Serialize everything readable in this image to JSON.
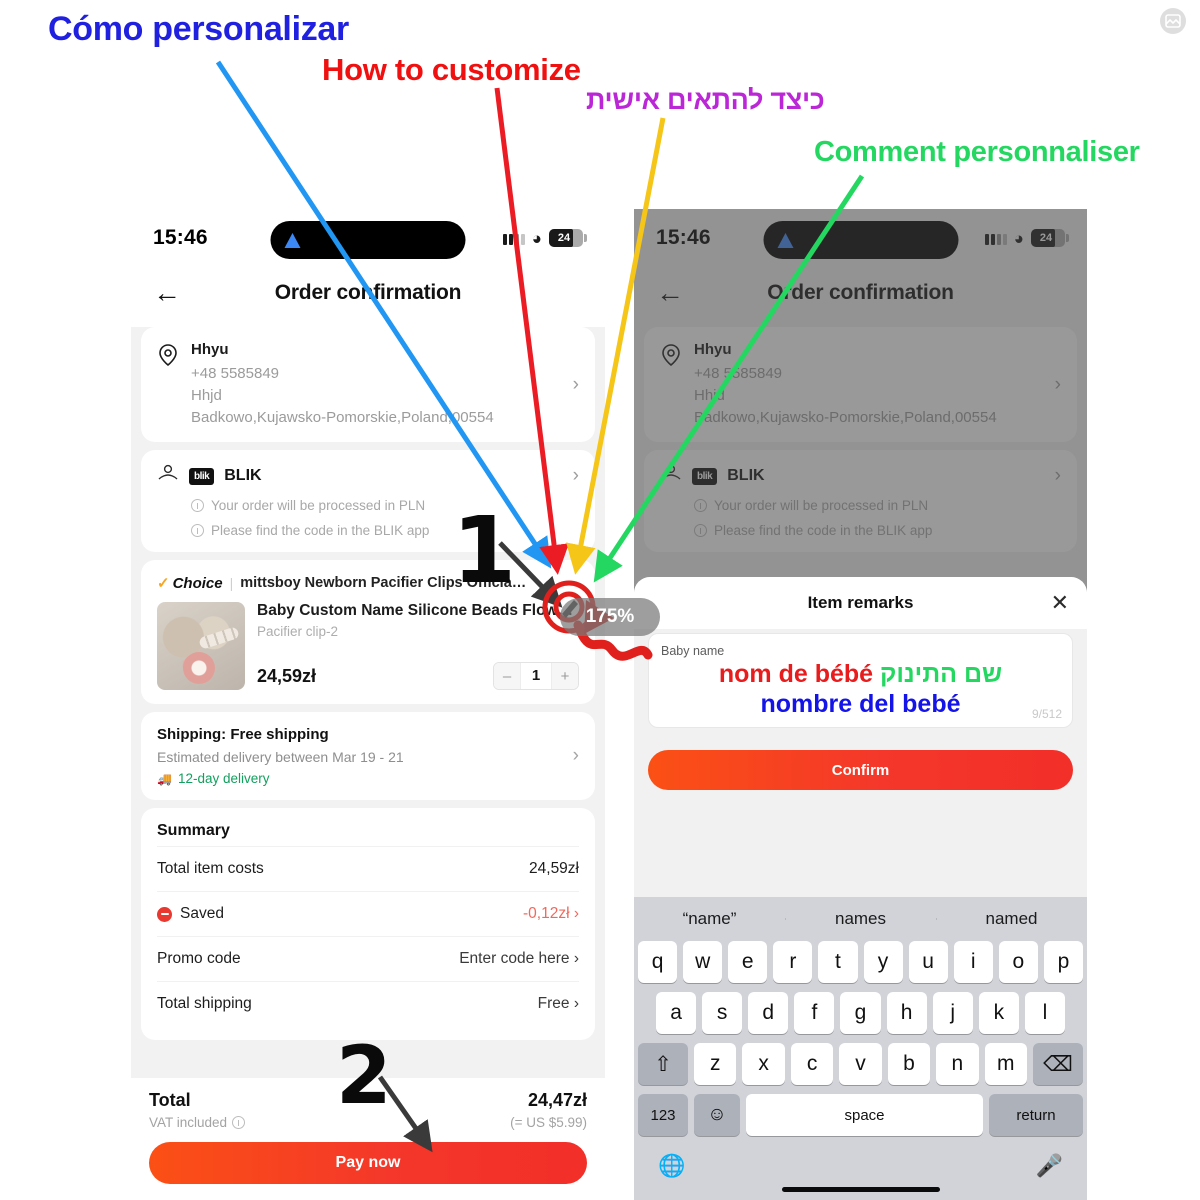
{
  "annotations": {
    "labels": [
      {
        "id": "anno-es",
        "text": "Cómo personalizar",
        "color": "#2020e0"
      },
      {
        "id": "anno-en",
        "text": "How to customize",
        "color": "#f01010"
      },
      {
        "id": "anno-he",
        "text": "כיצד להתאים אישית",
        "color": "#bb27d6"
      },
      {
        "id": "anno-fr",
        "text": "Comment personnaliser",
        "color": "#24d760"
      }
    ],
    "step_one": "1",
    "step_two": "2",
    "zoom_badge": "175%"
  },
  "phone_left": {
    "status": {
      "time": "15:46",
      "battery": "24",
      "wifi_icon": "wifi-icon",
      "signal_icon": "signal-dots-icon",
      "nav_icon": "navigation-arrow-icon"
    },
    "header": {
      "back_icon": "back-arrow-icon",
      "title": "Order confirmation"
    },
    "address": {
      "pin_icon": "location-pin-icon",
      "name": "Hhyu",
      "phone": "+48 5585849",
      "line2": "Hhjd",
      "line3": "Badkowo,Kujawsko-Pomorskie,Poland,00554",
      "chevron": "›"
    },
    "payment": {
      "wallet_icon": "wallet-hand-icon",
      "logo_text": "blik",
      "name": "BLIK",
      "chevron": "›",
      "note1": "Your order will be processed in PLN",
      "note2": "Please find the code in the BLIK app"
    },
    "product": {
      "choice_label": "Choice",
      "choice_tick": "✓",
      "separator": "|",
      "store": "mittsboy Newborn Pacifier Clips Official St...",
      "title": "Baby Custom Name Silicone Beads Flower...",
      "variant": "Pacifier clip-2",
      "price": "24,59zł",
      "qty": "1",
      "minus": "–",
      "plus": "+",
      "edit_icon": "pencil-edit-icon"
    },
    "shipping": {
      "title": "Shipping: Free shipping",
      "estimate": "Estimated delivery between Mar 19 - 21",
      "fast": "12-day delivery",
      "truck_icon": "truck-icon",
      "chevron": "›"
    },
    "summary": {
      "title": "Summary",
      "rows": [
        {
          "label": "Total item costs",
          "value": "24,59zł",
          "style": "plain",
          "chevron": ""
        },
        {
          "label": "Saved",
          "value": "-0,12zł",
          "style": "neg",
          "chevron": "›"
        },
        {
          "label": "Promo code",
          "value": "Enter code here",
          "style": "muted",
          "chevron": "›"
        },
        {
          "label": "Total shipping",
          "value": "Free",
          "style": "muted",
          "chevron": "›"
        }
      ]
    },
    "bottom": {
      "total_label": "Total",
      "vat_text": "VAT included",
      "vat_icon": "info-icon",
      "total_amount": "24,47zł",
      "total_usd": "(= US $5.99)",
      "pay_button": "Pay now"
    }
  },
  "phone_right": {
    "status": {
      "time": "15:46",
      "battery": "24",
      "wifi_icon": "wifi-icon",
      "signal_icon": "signal-dots-icon",
      "nav_icon": "navigation-arrow-icon"
    },
    "header": {
      "back_icon": "back-arrow-icon",
      "title": "Order confirmation"
    },
    "address": {
      "pin_icon": "location-pin-icon",
      "name": "Hhyu",
      "phone": "+48 5585849",
      "line2": "Hhjd",
      "line3": "Badkowo,Kujawsko-Pomorskie,Poland,00554",
      "chevron": "›"
    },
    "payment": {
      "wallet_icon": "wallet-hand-icon",
      "logo_text": "blik",
      "name": "BLIK",
      "chevron": "›",
      "note1": "Your order will be processed in PLN",
      "note2": "Please find the code in the BLIK app"
    },
    "sheet": {
      "title": "Item remarks",
      "close_icon": "close-x-icon",
      "field_label": "Baby name",
      "value_fr": "nom de bébé",
      "value_he": "שם התינוק",
      "value_es": "nombre del bebé",
      "char_count": "9/512",
      "confirm_button": "Confirm"
    },
    "keyboard": {
      "predictions": [
        "“name”",
        "names",
        "named"
      ],
      "row1": [
        "q",
        "w",
        "e",
        "r",
        "t",
        "y",
        "u",
        "i",
        "o",
        "p"
      ],
      "row2": [
        "a",
        "s",
        "d",
        "f",
        "g",
        "h",
        "j",
        "k",
        "l"
      ],
      "row3": [
        "z",
        "x",
        "c",
        "v",
        "b",
        "n",
        "m"
      ],
      "shift_icon": "shift-arrow-icon",
      "delete_icon": "backspace-icon",
      "num_key": "123",
      "emoji_icon": "emoji-smiley-icon",
      "space_key": "space",
      "return_key": "return",
      "globe_icon": "globe-language-icon",
      "mic_icon": "microphone-icon"
    }
  },
  "corner": {
    "icon": "image-placeholder-icon"
  },
  "colors": {
    "accent_orange": "#fb5015",
    "accent_red": "#f22f29",
    "saved_red": "#f0695e",
    "green": "#13a05e"
  }
}
